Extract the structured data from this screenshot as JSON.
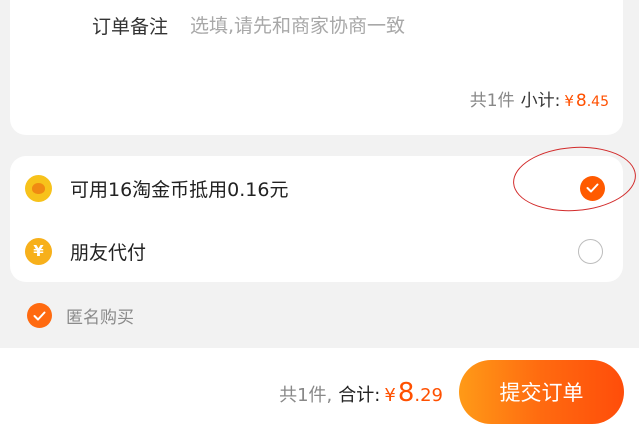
{
  "order_note": {
    "label": "订单备注",
    "placeholder": "选填,请先和商家协商一致"
  },
  "subtotal": {
    "count_text": "共1件",
    "label": "小计:",
    "currency": "¥",
    "amount_int": "8",
    "amount_dec": ".45"
  },
  "options": {
    "coin": {
      "label": "可用16淘金币抵用0.16元",
      "checked": true,
      "icon": "gold-coin-icon"
    },
    "friend_pay": {
      "label": "朋友代付",
      "checked": false,
      "icon": "yen-coin-icon"
    }
  },
  "anonymous": {
    "label": "匿名购买",
    "checked": true
  },
  "footer": {
    "count_text": "共1件,",
    "total_label": "合计:",
    "currency": "¥",
    "amount_int": "8",
    "amount_dec": ".29",
    "submit_label": "提交订单"
  },
  "colors": {
    "accent": "#ff5000",
    "annotation": "#d22b2b"
  }
}
